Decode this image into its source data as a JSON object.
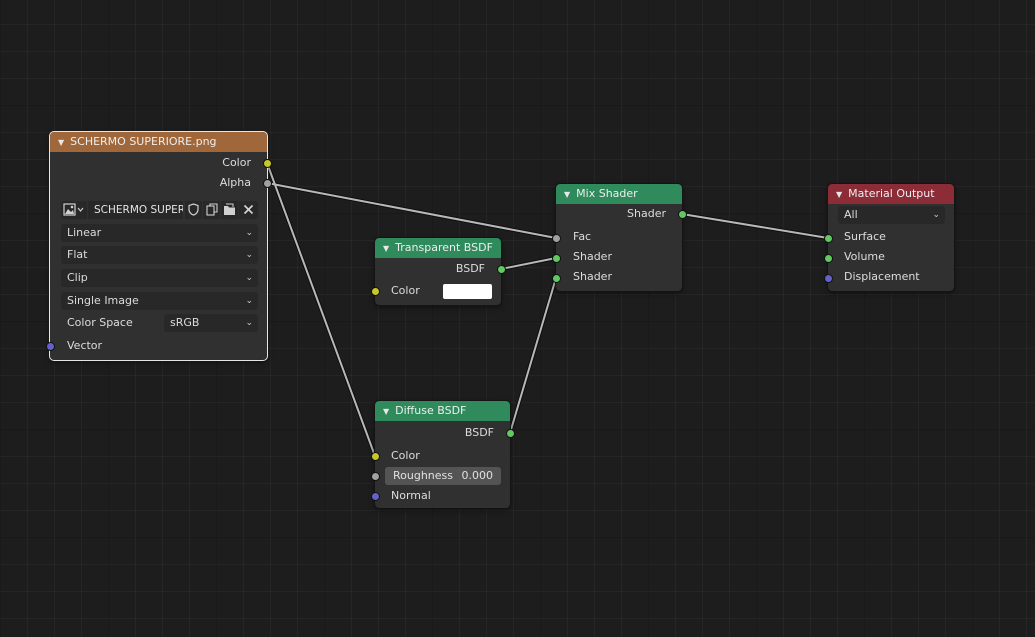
{
  "nodes": {
    "image_texture": {
      "title": "SCHERMO SUPERIORE.png",
      "outputs": {
        "color": "Color",
        "alpha": "Alpha"
      },
      "image_name": "SCHERMO SUPER..",
      "interpolation": "Linear",
      "projection": "Flat",
      "extension": "Clip",
      "source": "Single Image",
      "color_space_label": "Color Space",
      "color_space_value": "sRGB",
      "inputs": {
        "vector": "Vector"
      }
    },
    "transparent_bsdf": {
      "title": "Transparent BSDF",
      "outputs": {
        "bsdf": "BSDF"
      },
      "inputs": {
        "color": "Color"
      },
      "color_value": "#ffffff"
    },
    "diffuse_bsdf": {
      "title": "Diffuse BSDF",
      "outputs": {
        "bsdf": "BSDF"
      },
      "inputs": {
        "color": "Color",
        "roughness": "Roughness",
        "normal": "Normal"
      },
      "roughness_value": "0.000"
    },
    "mix_shader": {
      "title": "Mix Shader",
      "outputs": {
        "shader": "Shader"
      },
      "inputs": {
        "fac": "Fac",
        "shader1": "Shader",
        "shader2": "Shader"
      }
    },
    "material_output": {
      "title": "Material Output",
      "target": "All",
      "inputs": {
        "surface": "Surface",
        "volume": "Volume",
        "displacement": "Displacement"
      }
    }
  },
  "colors": {
    "background": "#1d1d1d",
    "node_body": "#303030",
    "header_texture": "#a0673a",
    "header_shader": "#2f8a5c",
    "header_output": "#8b2c37",
    "socket_color": "#c7c729",
    "socket_float": "#a1a1a1",
    "socket_shader": "#63c763",
    "socket_vector": "#6363c7",
    "wire": "#b8b8b8"
  }
}
